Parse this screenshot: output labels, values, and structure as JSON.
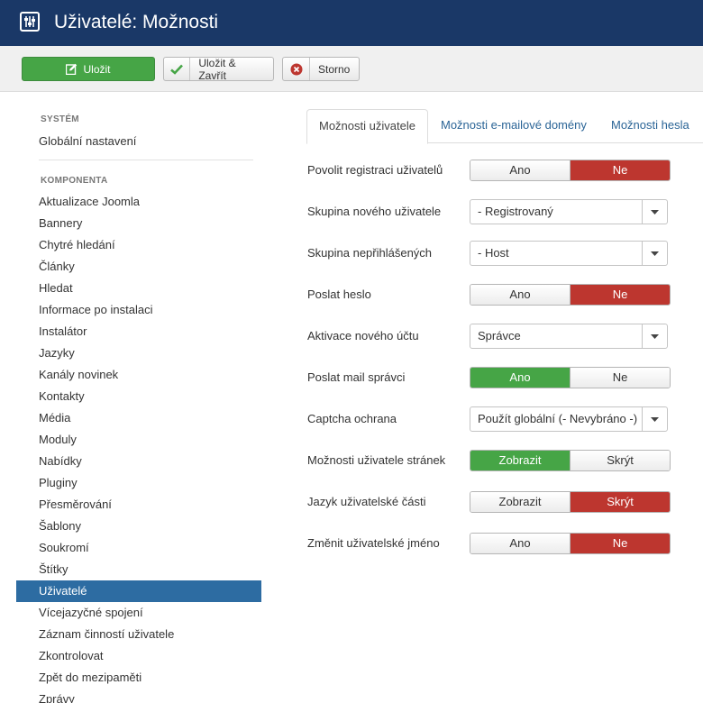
{
  "header": {
    "title": "Uživatelé: Možnosti"
  },
  "toolbar": {
    "save_label": "Uložit",
    "save_close_label": "Uložit & Zavřít",
    "cancel_label": "Storno"
  },
  "sidebar": {
    "system_heading": "SYSTÉM",
    "global_settings": "Globální nastavení",
    "component_heading": "KOMPONENTA",
    "items": [
      {
        "label": "Aktualizace Joomla"
      },
      {
        "label": "Bannery"
      },
      {
        "label": "Chytré hledání"
      },
      {
        "label": "Články"
      },
      {
        "label": "Hledat"
      },
      {
        "label": "Informace po instalaci"
      },
      {
        "label": "Instalátor"
      },
      {
        "label": "Jazyky"
      },
      {
        "label": "Kanály novinek"
      },
      {
        "label": "Kontakty"
      },
      {
        "label": "Média"
      },
      {
        "label": "Moduly"
      },
      {
        "label": "Nabídky"
      },
      {
        "label": "Pluginy"
      },
      {
        "label": "Přesměrování"
      },
      {
        "label": "Šablony"
      },
      {
        "label": "Soukromí"
      },
      {
        "label": "Štítky"
      },
      {
        "label": "Uživatelé",
        "active": true
      },
      {
        "label": "Vícejazyčné spojení"
      },
      {
        "label": "Záznam činností uživatele"
      },
      {
        "label": "Zkontrolovat"
      },
      {
        "label": "Zpět do mezipaměti"
      },
      {
        "label": "Zprávy"
      }
    ]
  },
  "tabs": [
    {
      "label": "Možnosti uživatele",
      "active": true
    },
    {
      "label": "Možnosti e-mailové domény"
    },
    {
      "label": "Možnosti hesla"
    }
  ],
  "form": {
    "rows": [
      {
        "label": "Povolit registraci uživatelů",
        "type": "toggle",
        "options": [
          "Ano",
          "Ne"
        ],
        "selected": "Ne",
        "selected_color": "red"
      },
      {
        "label": "Skupina nového uživatele",
        "type": "select",
        "value": "- Registrovaný"
      },
      {
        "label": "Skupina nepřihlášených",
        "type": "select",
        "value": "- Host"
      },
      {
        "label": "Poslat heslo",
        "type": "toggle",
        "options": [
          "Ano",
          "Ne"
        ],
        "selected": "Ne",
        "selected_color": "red"
      },
      {
        "label": "Aktivace nového účtu",
        "type": "select",
        "value": "Správce"
      },
      {
        "label": "Poslat mail správci",
        "type": "toggle",
        "options": [
          "Ano",
          "Ne"
        ],
        "selected": "Ano",
        "selected_color": "green"
      },
      {
        "label": "Captcha ochrana",
        "type": "select",
        "value": "Použít globální (- Nevybráno -)"
      },
      {
        "label": "Možnosti uživatele stránek",
        "type": "toggle",
        "options": [
          "Zobrazit",
          "Skrýt"
        ],
        "selected": "Zobrazit",
        "selected_color": "green"
      },
      {
        "label": "Jazyk uživatelské části",
        "type": "toggle",
        "options": [
          "Zobrazit",
          "Skrýt"
        ],
        "selected": "Skrýt",
        "selected_color": "red"
      },
      {
        "label": "Změnit uživatelské jméno",
        "type": "toggle",
        "options": [
          "Ano",
          "Ne"
        ],
        "selected": "Ne",
        "selected_color": "red"
      }
    ]
  },
  "colors": {
    "header_bg": "#1a3867",
    "save_green": "#46a546",
    "active_green": "#46a546",
    "active_red": "#bd362f",
    "sidebar_active": "#2d6ca2",
    "link_blue": "#2a6496"
  },
  "icons": {
    "app_logo": "sliders-icon",
    "save": "edit-icon",
    "save_close": "check-icon",
    "cancel": "cancel-circle-icon",
    "select_arrow": "caret-down-icon"
  }
}
